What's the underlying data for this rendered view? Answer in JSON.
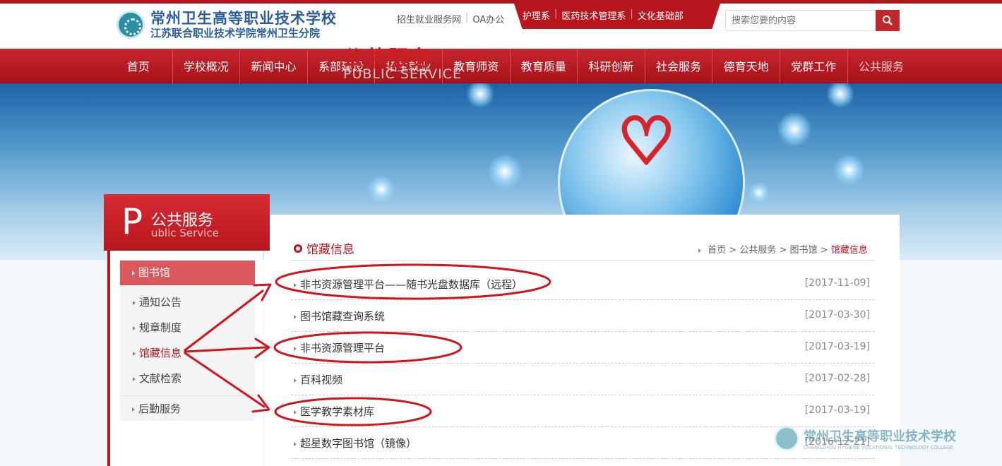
{
  "header": {
    "school_name_line1": "常州卫生高等职业技术学校",
    "school_name_line2": "江苏联合职业技术学院常州卫生分院",
    "top_links": [
      "招生就业服务网",
      "OA办公"
    ],
    "dept_links": [
      "护理系",
      "医药技术管理系",
      "文化基础部"
    ],
    "search_placeholder": "搜索您要的内容"
  },
  "nav": [
    "首页",
    "学校概况",
    "新闻中心",
    "系部建设",
    "招生就业",
    "教育师资",
    "教育质量",
    "科研创新",
    "社会服务",
    "德育天地",
    "党群工作",
    "公共服务"
  ],
  "banner": {
    "title": "公共服务",
    "subtitle": "PUBLIC SERVICE"
  },
  "sidebar": {
    "big_letter": "P",
    "title": "公共服务",
    "subtitle": "ublic Service",
    "active": "图书馆",
    "subitems": [
      "通知公告",
      "规章制度",
      "馆藏信息",
      "文献检索"
    ],
    "last": "后勤服务"
  },
  "section": {
    "title": "馆藏信息",
    "breadcrumb": [
      "首页",
      "公共服务",
      "图书馆",
      "馆藏信息"
    ]
  },
  "list": [
    {
      "title": "非书资源管理平台——随书光盘数据库（远程）",
      "date": "[2017-11-09]"
    },
    {
      "title": "图书馆藏查询系统",
      "date": "[2017-03-30]"
    },
    {
      "title": "非书资源管理平台",
      "date": "[2017-03-19]"
    },
    {
      "title": "百科视频",
      "date": "[2017-02-28]"
    },
    {
      "title": "医学教学素材库",
      "date": "[2017-03-19]"
    },
    {
      "title": "超星数字图书馆（镜像）",
      "date": "[2016-12-21]"
    }
  ],
  "watermark": {
    "name": "常州卫生高等职业技术学校",
    "english": "CHANGZHOU HYGIENE VOCATIONAL TECHNOLOGY COLLEGE"
  },
  "colors": {
    "brand_red": "#b8161d",
    "nav_red": "#c8262e",
    "annotation_red": "#d0151c"
  }
}
